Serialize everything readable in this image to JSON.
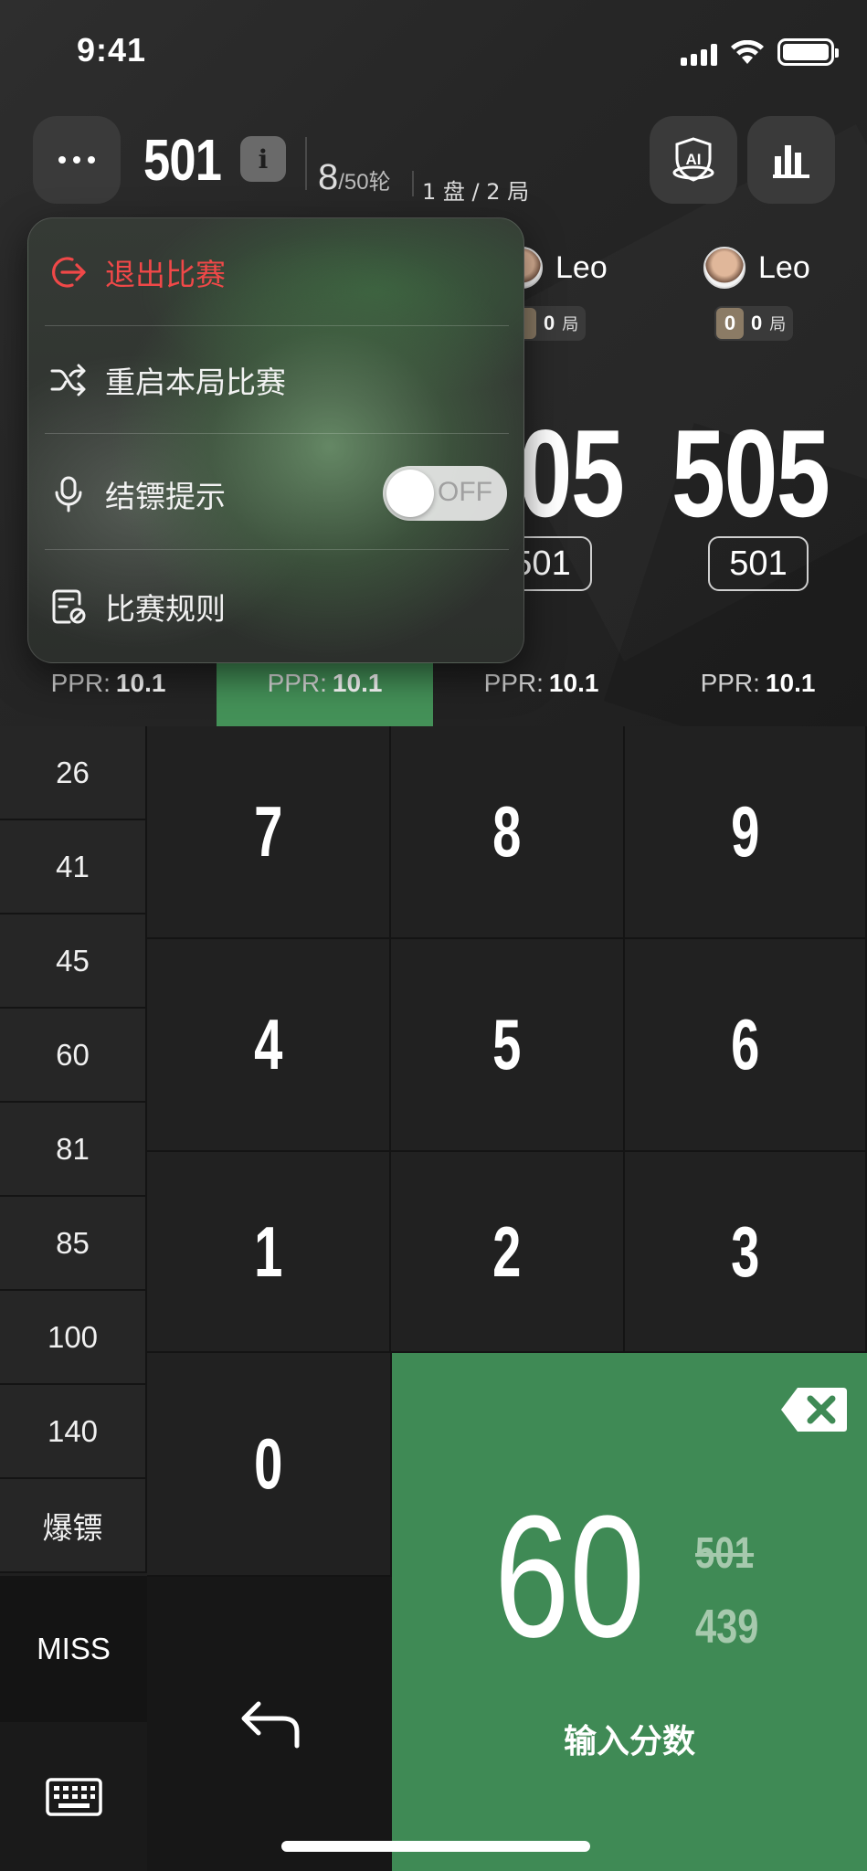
{
  "status_bar": {
    "time": "9:41"
  },
  "header": {
    "game_title": "501",
    "info_icon_text": "i",
    "round_current": "8",
    "round_total": "/50轮",
    "set_info": "1 盘 / 2 局",
    "ai_label": "AI"
  },
  "players": [
    {
      "name": "Leo",
      "sets": "",
      "legs": "0",
      "legs_unit": "局",
      "score": "505",
      "start": "501",
      "ppr_label": "PPR:",
      "ppr": "10.1"
    },
    {
      "name": "Leo",
      "sets": "0",
      "legs": "0",
      "legs_unit": "局",
      "score": "505",
      "start": "501",
      "ppr_label": "PPR:",
      "ppr": "10.1"
    }
  ],
  "ppr_row": [
    {
      "label": "PPR:",
      "value": "10.1",
      "active": false
    },
    {
      "label": "PPR:",
      "value": "10.1",
      "active": true
    },
    {
      "label": "PPR:",
      "value": "10.1",
      "active": false
    },
    {
      "label": "PPR:",
      "value": "10.1",
      "active": false
    }
  ],
  "menu": {
    "items": [
      {
        "label": "退出比赛",
        "icon": "exit-icon"
      },
      {
        "label": "重启本局比赛",
        "icon": "shuffle-icon"
      },
      {
        "label": "结镖提示",
        "icon": "microphone-icon"
      },
      {
        "label": "比赛规则",
        "icon": "rules-icon"
      }
    ],
    "toggle_state": "OFF"
  },
  "quick_scores": [
    "26",
    "41",
    "45",
    "60",
    "81",
    "85",
    "100",
    "140",
    "爆镖"
  ],
  "miss_label": "MISS",
  "keypad": [
    "7",
    "8",
    "9",
    "4",
    "5",
    "6",
    "1",
    "2",
    "3",
    "0"
  ],
  "entry": {
    "value": "60",
    "previous": "501",
    "remaining": "439",
    "label": "输入分数"
  },
  "colors": {
    "accent_green": "#3f8a55",
    "danger_red": "#f04848"
  }
}
